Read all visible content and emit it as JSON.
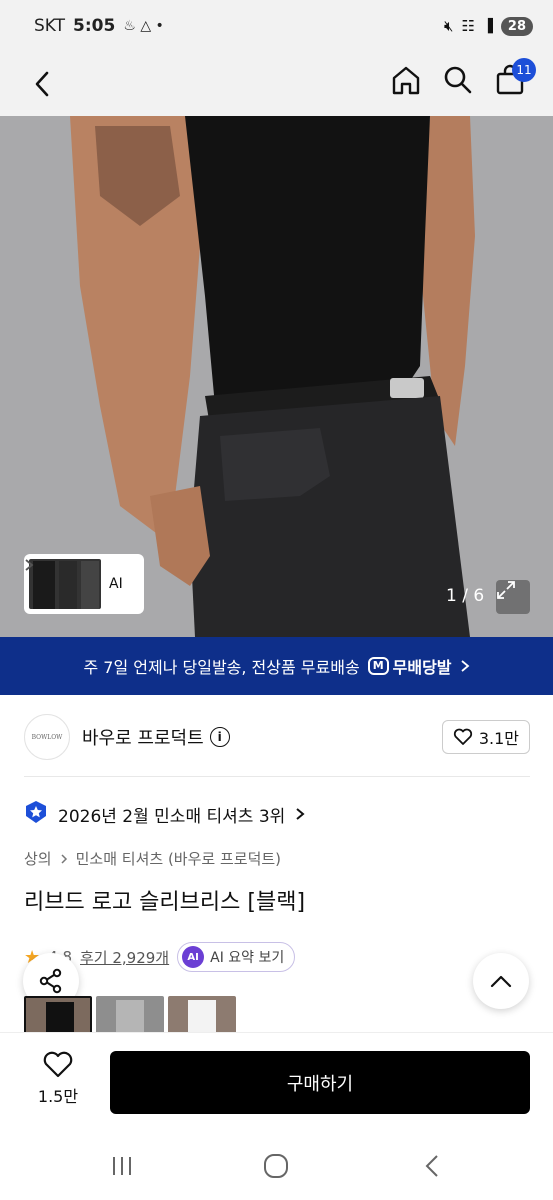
{
  "status_bar": {
    "carrier": "SKT",
    "time": "5:05",
    "battery": "28"
  },
  "top_nav": {
    "cart_count": "11"
  },
  "hero": {
    "thumb_label": "AI",
    "counter": "1 / 6"
  },
  "banner": {
    "text": "주 7일 언제나 당일발송, 전상품 무료배송",
    "badge_text": "무배당발",
    "badge_mark": "M"
  },
  "brand": {
    "logo_text": "BOWLOW",
    "name": "바우로 프로덕트",
    "likes": "3.1만"
  },
  "ranking": {
    "text": "2026년 2월 민소매 티셔츠 3위"
  },
  "breadcrumb": {
    "category": "상의",
    "subcategory": "민소매 티셔츠 (바우로 프로덕트)"
  },
  "product": {
    "title": "리브드 로고 슬리브리스 [블랙]"
  },
  "reviews": {
    "rating": "4.8",
    "review_link": "후기 2,929개",
    "ai_badge": "AI",
    "ai_summary": "AI 요약 보기"
  },
  "bottom_bar": {
    "wish_count": "1.5만",
    "buy_label": "구매하기"
  },
  "colors": {
    "banner": "#0e2f8a",
    "accent": "#1d4fd8",
    "buy_button": "#000000",
    "ai": "#6b3fd4"
  }
}
